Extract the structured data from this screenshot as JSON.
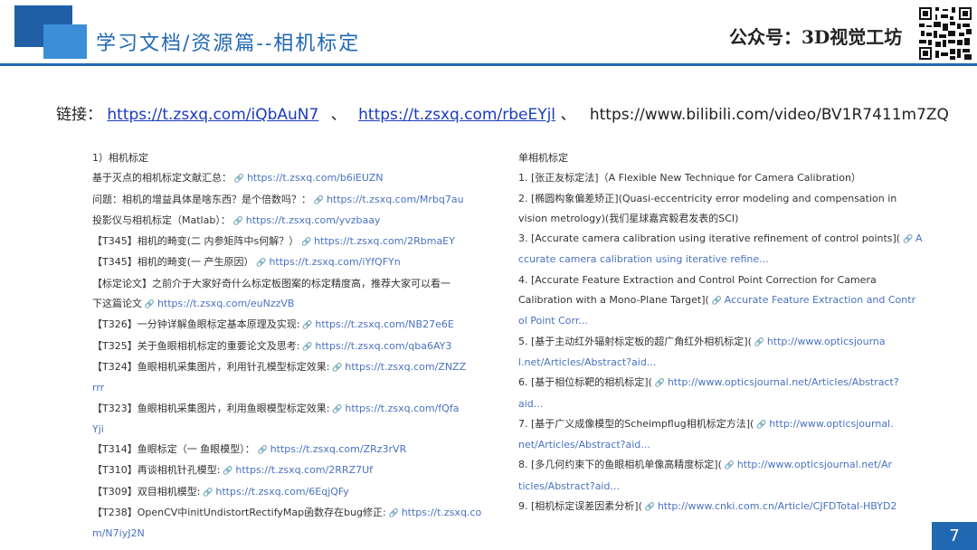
{
  "header": {
    "title": "学习文档/资源篇--相机标定",
    "account": "公众号：3D视觉工坊"
  },
  "links": {
    "label": "链接：",
    "link1": "https://t.zsxq.com/iQbAuN7",
    "sep1": "、",
    "link2": "https://t.zsxq.com/rbeEYjl",
    "sep2": "、",
    "link3": "https://www.bilibili.com/video/BV1R7411m7ZQ"
  },
  "left_column": [
    {
      "text": "1）相机标定",
      "link": ""
    },
    {
      "text": "基于灭点的相机标定文献汇总：",
      "link": "https://t.zsxq.com/b6iEUZN"
    },
    {
      "text": "问题：相机的增益具体是啥东西？是个倍数吗？：",
      "link": "https://t.zsxq.com/Mrbq7au"
    },
    {
      "text": "投影仪与相机标定（Matlab）：",
      "link": "https://t.zsxq.com/yvzbaay"
    },
    {
      "text": "【T345】相机的畸变(二 内参矩阵中s何解？）",
      "link": "https://t.zsxq.com/2RbmaEY"
    },
    {
      "text": "【T345】相机的畸变(一 产生原因）",
      "link": "https://t.zsxq.com/iYfQFYn"
    },
    {
      "text": "【标定论文】之前介于大家好奇什么标定板图案的标定精度高，推荐大家可以看一",
      "link": ""
    },
    {
      "text": "下这篇论文",
      "link": "https://t.zsxq.com/euNzzVB"
    },
    {
      "text": "【T326】一分钟详解鱼眼标定基本原理及实现:",
      "link": "https://t.zsxq.com/NB27e6E"
    },
    {
      "text": "【T325】关于鱼眼相机标定的重要论文及思考:",
      "link": "https://t.zsxq.com/qba6AY3"
    },
    {
      "text": "【T324】鱼眼相机采集图片，利用针孔模型标定效果:",
      "link": "https://t.zsxq.com/ZNZZ"
    },
    {
      "text": "",
      "link": "rrr"
    },
    {
      "text": "【T323】鱼眼相机采集图片，利用鱼眼模型标定效果:",
      "link": "https://t.zsxq.com/fQfa"
    },
    {
      "text": "",
      "link": "Yji"
    },
    {
      "text": "【T314】鱼眼标定（一 鱼眼模型）：",
      "link": "https://t.zsxq.com/ZRz3rVR"
    },
    {
      "text": "【T310】再谈相机针孔模型:",
      "link": "https://t.zsxq.com/2RRZ7Uf"
    },
    {
      "text": "【T309】双目相机模型:",
      "link": "https://t.zsxq.com/6EqjQFy"
    },
    {
      "text": "【T238】OpenCV中initUndistortRectifyMap函数存在bug修正:",
      "link": "https://t.zsxq.co"
    },
    {
      "text": "",
      "link": "m/N7iyJ2N"
    }
  ],
  "right_column": [
    {
      "text": "单相机标定",
      "link": ""
    },
    {
      "text": "1. [张正友标定法]（A Flexible New Technique for Camera Calibration）",
      "link": ""
    },
    {
      "text": "2. [椭圆构象偏差矫正](Quasi-eccentricity error modeling and compensation in",
      "link": ""
    },
    {
      "text": "vision metrology)(我们星球嘉宾毅君发表的SCI)",
      "link": ""
    },
    {
      "text": "3. [Accurate camera calibration using iterative refinement of control points](",
      "link": "A"
    },
    {
      "text": "",
      "link": "ccurate camera calibration using iterative refine..."
    },
    {
      "text": "4. [Accurate Feature Extraction and Control Point Correction for Camera",
      "link": ""
    },
    {
      "text": "Calibration with a Mono-Plane Target](",
      "link": "Accurate Feature Extraction and Contr"
    },
    {
      "text": "",
      "link": "ol Point Corr..."
    },
    {
      "text": "5. [基于主动红外辐射标定板的超广角红外相机标定](",
      "link": "http://www.opticsjourna"
    },
    {
      "text": "",
      "link": "l.net/Articles/Abstract?aid..."
    },
    {
      "text": "6. [基于相位标靶的相机标定](",
      "link": "http://www.opticsjournal.net/Articles/Abstract?"
    },
    {
      "text": "",
      "link": "aid..."
    },
    {
      "text": "7. [基于广义成像模型的Scheimpflug相机标定方法](",
      "link": "http://www.opticsjournal."
    },
    {
      "text": "",
      "link": "net/Articles/Abstract?aid..."
    },
    {
      "text": "8. [多几何约束下的鱼眼相机单像高精度标定](",
      "link": "http://www.opticsjournal.net/Ar"
    },
    {
      "text": "",
      "link": "ticles/Abstract?aid..."
    },
    {
      "text": "9. [相机标定误差因素分析](",
      "link": "http://www.cnki.com.cn/Article/CJFDTotal-HBYD2"
    }
  ],
  "page_number": "7",
  "colors": {
    "brand": "#2168b3",
    "accent": "#3c8fd6",
    "link": "#1a3bbd"
  }
}
